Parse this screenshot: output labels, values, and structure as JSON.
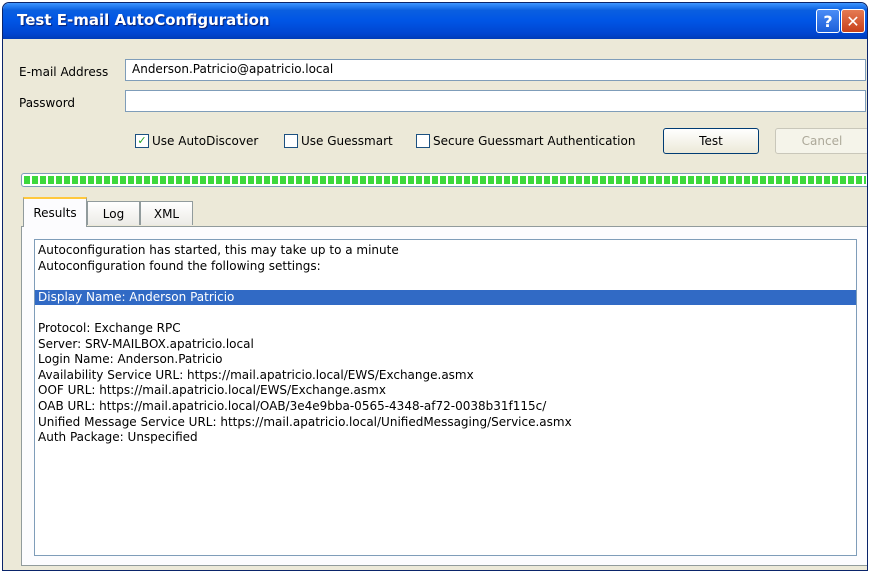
{
  "window": {
    "title": "Test E-mail AutoConfiguration",
    "help_label": "?",
    "close_label": "✕"
  },
  "form": {
    "email_label": "E-mail Address",
    "email_value": "Anderson.Patricio@apatricio.local",
    "password_label": "Password",
    "password_value": ""
  },
  "options": {
    "use_autodiscover": {
      "label": "Use AutoDiscover",
      "checked": true
    },
    "use_guessmart": {
      "label": "Use Guessmart",
      "checked": false
    },
    "secure_guessmart": {
      "label": "Secure Guessmart Authentication",
      "checked": false
    },
    "check_glyph": "✓"
  },
  "buttons": {
    "test": "Test",
    "cancel": "Cancel"
  },
  "progress": {
    "value": 1.0,
    "color": "#3cd83c"
  },
  "tabs": [
    {
      "label": "Results",
      "active": true
    },
    {
      "label": "Log",
      "active": false
    },
    {
      "label": "XML",
      "active": false
    }
  ],
  "results": {
    "lines": [
      "Autoconfiguration has started, this may take up to a minute",
      "Autoconfiguration found the following settings:",
      "",
      "Display Name: Anderson Patricio",
      "",
      "Protocol: Exchange RPC",
      "Server: SRV-MAILBOX.apatricio.local",
      "Login Name: Anderson.Patricio",
      "Availability Service URL: https://mail.apatricio.local/EWS/Exchange.asmx",
      "OOF URL: https://mail.apatricio.local/EWS/Exchange.asmx",
      "OAB URL: https://mail.apatricio.local/OAB/3e4e9bba-0565-4348-af72-0038b31f115c/",
      "Unified Message Service URL: https://mail.apatricio.local/UnifiedMessaging/Service.asmx",
      "Auth Package: Unspecified"
    ],
    "selected_index": 3,
    "selection_color": "#316ac5"
  }
}
